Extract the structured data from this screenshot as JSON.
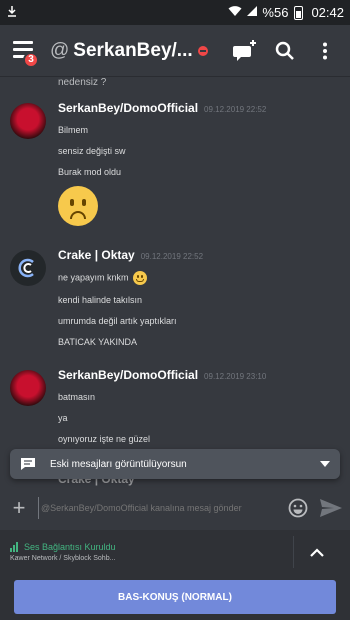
{
  "statusbar": {
    "battery": "%56",
    "time": "02:42"
  },
  "header": {
    "menu_badge": "3",
    "channel_prefix": "@",
    "channel_name": "SerkanBey/..."
  },
  "messages": {
    "top_text": "nedensiz ?",
    "groups": [
      {
        "author": "SerkanBey/DomoOfficial",
        "time": "09.12.2019 22:52",
        "lines": [
          "Bilmem",
          "sensiz değişti sw",
          "Burak mod oldu"
        ]
      },
      {
        "author": "Crake | Oktay",
        "time": "09.12.2019 22:52",
        "lines": [
          "ne yapayım knkm",
          "kendi halinde takılsın",
          "umrumda değil artık yaptıkları",
          "BATICAK YAKINDA"
        ]
      },
      {
        "author": "SerkanBey/DomoOfficial",
        "time": "09.12.2019 23:10",
        "lines": [
          "batmasın",
          "ya",
          "oynıyoruz işte ne güzel"
        ]
      }
    ],
    "ghost_author": "Crake | Oktay"
  },
  "banner": {
    "text": "Eski mesajları görüntülüyorsun"
  },
  "composer": {
    "placeholder": "@SerkanBey/DomoOfficial kanalına mesaj gönder"
  },
  "voice": {
    "status": "Ses Bağlantısı Kuruldu",
    "channel": "Kawer Network / Skyblock Sohb..."
  },
  "ptt": {
    "label": "BAS-KONUŞ (NORMAL)"
  },
  "colors": {
    "blurple": "#7289da",
    "green": "#43b581",
    "red": "#f04747",
    "bg": "#36393f"
  }
}
